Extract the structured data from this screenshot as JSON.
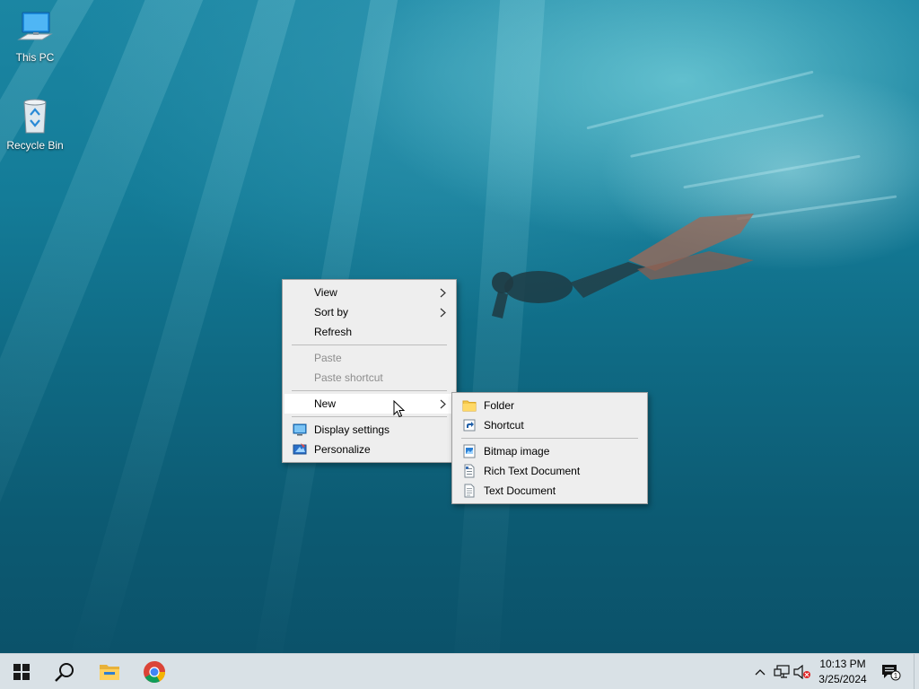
{
  "desktop": {
    "icons": [
      {
        "label": "This PC",
        "icon": "computer-icon"
      },
      {
        "label": "Recycle Bin",
        "icon": "recycle-bin-icon"
      }
    ]
  },
  "context_menu": {
    "items": {
      "view": {
        "label": "View",
        "submenu": true
      },
      "sort_by": {
        "label": "Sort by",
        "submenu": true
      },
      "refresh": {
        "label": "Refresh"
      },
      "paste": {
        "label": "Paste",
        "disabled": true
      },
      "paste_shortcut": {
        "label": "Paste shortcut",
        "disabled": true
      },
      "new": {
        "label": "New",
        "submenu": true,
        "highlighted": true
      },
      "display_settings": {
        "label": "Display settings",
        "icon": "display-icon"
      },
      "personalize": {
        "label": "Personalize",
        "icon": "personalize-icon"
      }
    }
  },
  "new_submenu": {
    "items": {
      "folder": {
        "label": "Folder",
        "icon": "folder-icon"
      },
      "shortcut": {
        "label": "Shortcut",
        "icon": "shortcut-icon"
      },
      "bitmap": {
        "label": "Bitmap image",
        "icon": "bitmap-icon"
      },
      "rtf": {
        "label": "Rich Text Document",
        "icon": "rtf-icon"
      },
      "text": {
        "label": "Text Document",
        "icon": "text-doc-icon"
      }
    }
  },
  "taskbar": {
    "pinned": [
      "start-icon",
      "search-icon",
      "file-explorer-icon",
      "chrome-icon"
    ],
    "tray": [
      "chevron-up-icon",
      "network-icon",
      "volume-muted-icon"
    ],
    "clock": {
      "time": "10:13 PM",
      "date": "3/25/2024"
    },
    "notifications": {
      "icon": "action-center-icon",
      "count": "1"
    }
  },
  "colors": {
    "menu_bg": "#eeeeee",
    "menu_highlight": "#ffffff",
    "taskbar_bg": "#d9e1e6",
    "accent_blue": "#0078d7"
  }
}
